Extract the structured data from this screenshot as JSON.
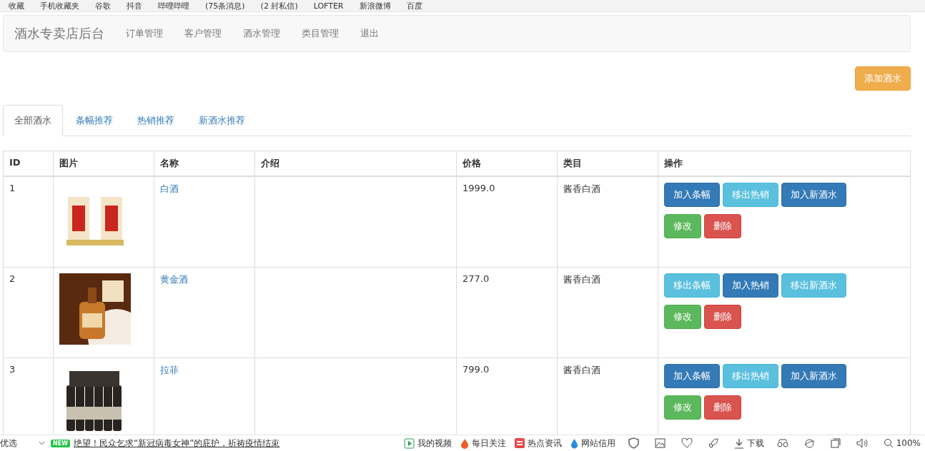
{
  "bookmarks": [
    "收藏",
    "手机收藏夹",
    "谷歌",
    "抖音",
    "哔哩哔哩",
    "(75条消息)",
    "(2 封私信)",
    "LOFTER",
    "新浪微博",
    "百度"
  ],
  "navbar": {
    "brand": "酒水专卖店后台",
    "links": [
      "订单管理",
      "客户管理",
      "酒水管理",
      "类目管理",
      "退出"
    ]
  },
  "add_button": "添加酒水",
  "tabs": [
    {
      "label": "全部酒水",
      "selected": true
    },
    {
      "label": "条幅推荐",
      "selected": false
    },
    {
      "label": "热销推荐",
      "selected": false
    },
    {
      "label": "新酒水推荐",
      "selected": false
    }
  ],
  "table": {
    "columns": [
      "ID",
      "图片",
      "名称",
      "介绍",
      "价格",
      "类目",
      "操作"
    ],
    "rows": [
      {
        "id": "1",
        "name": "白酒",
        "intro": "",
        "price": "1999.0",
        "category": "酱香白酒",
        "actions": [
          {
            "label": "加入条幅",
            "kind": "primary"
          },
          {
            "label": "移出热销",
            "kind": "info"
          },
          {
            "label": "加入新酒水",
            "kind": "primary"
          },
          {
            "label": "修改",
            "kind": "success"
          },
          {
            "label": "删除",
            "kind": "danger"
          }
        ]
      },
      {
        "id": "2",
        "name": "黄金酒",
        "intro": "",
        "price": "277.0",
        "category": "酱香白酒",
        "actions": [
          {
            "label": "移出条幅",
            "kind": "info"
          },
          {
            "label": "加入热销",
            "kind": "primary"
          },
          {
            "label": "移出新酒水",
            "kind": "info"
          },
          {
            "label": "修改",
            "kind": "success"
          },
          {
            "label": "删除",
            "kind": "danger"
          }
        ]
      },
      {
        "id": "3",
        "name": "拉菲",
        "intro": "",
        "price": "799.0",
        "category": "酱香白酒",
        "actions": [
          {
            "label": "加入条幅",
            "kind": "primary"
          },
          {
            "label": "移出热销",
            "kind": "info"
          },
          {
            "label": "加入新酒水",
            "kind": "primary"
          },
          {
            "label": "修改",
            "kind": "success"
          },
          {
            "label": "删除",
            "kind": "danger"
          }
        ]
      }
    ]
  },
  "status_bar": {
    "left": "优选",
    "badge": "NEW",
    "headline": "绝望！民众乞求“新冠病毒女神”的庇护，祈祷疫情结束",
    "items": [
      "我的视频",
      "每日关注",
      "热点资讯",
      "网站信用"
    ],
    "download": "下载",
    "zoom": "100%"
  }
}
